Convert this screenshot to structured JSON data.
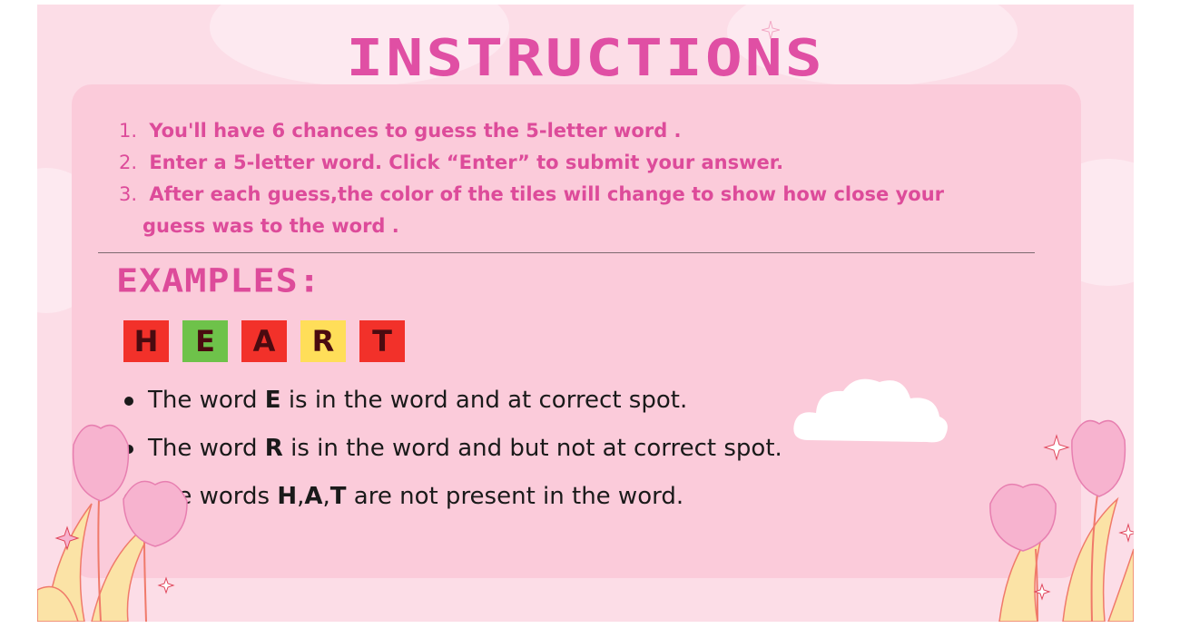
{
  "title": "INSTRUCTIONS",
  "steps": [
    {
      "num": "1.",
      "text": "You'll have 6 chances to guess the 5-letter word ."
    },
    {
      "num": "2.",
      "text": "Enter a 5-letter word. Click “Enter” to submit your answer."
    },
    {
      "num": "3.",
      "text": "After each guess,the color of the tiles will change to show how close your",
      "cont": "guess was to the word ."
    }
  ],
  "examples_heading": "EXAMPLES:",
  "tiles": [
    {
      "letter": "H",
      "color": "#f2312a"
    },
    {
      "letter": "E",
      "color": "#6ec24a"
    },
    {
      "letter": "A",
      "color": "#f2312a"
    },
    {
      "letter": "R",
      "color": "#ffde59"
    },
    {
      "letter": "T",
      "color": "#f2312a"
    }
  ],
  "bullets": [
    {
      "pre": "The word  ",
      "bold": "E",
      "post": " is in the word and at correct spot."
    },
    {
      "pre": "The word  ",
      "bold": "R",
      "post": " is in the word and but  not at correct spot."
    },
    {
      "pre": " The words  ",
      "bold_h": "H",
      "comma1": ",",
      "bold_a": "A",
      "comma2": ",",
      "bold_t": "T",
      "post": "  are not present in the word."
    }
  ],
  "colors": {
    "accent": "#dd4b9a",
    "background": "#fcdde7",
    "panel": "#fbcbda"
  },
  "icons": [
    "tulip-icon",
    "sparkle-icon",
    "cloud-icon"
  ]
}
